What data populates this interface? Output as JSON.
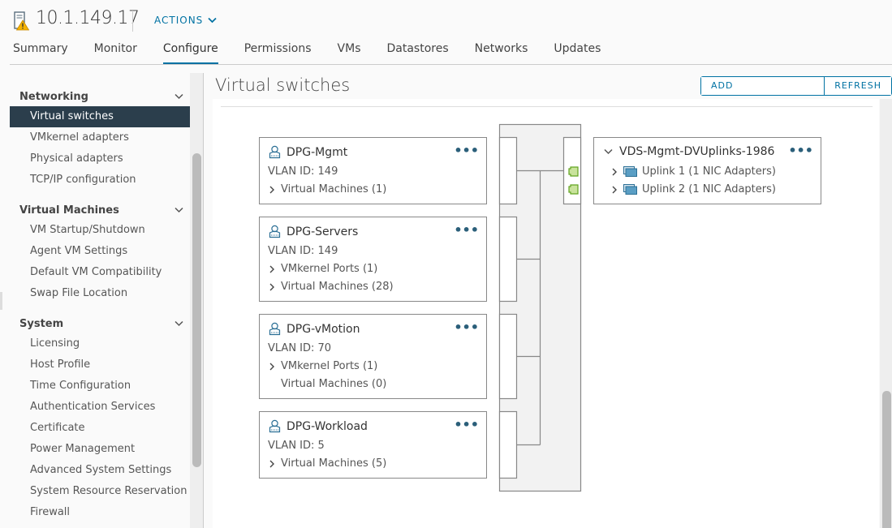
{
  "header": {
    "host_title": "10.1.149.17",
    "host_icon": "host-warning-icon",
    "actions_label": "ACTIONS",
    "tabs": [
      {
        "label": "Summary",
        "active": false
      },
      {
        "label": "Monitor",
        "active": false
      },
      {
        "label": "Configure",
        "active": true
      },
      {
        "label": "Permissions",
        "active": false
      },
      {
        "label": "VMs",
        "active": false
      },
      {
        "label": "Datastores",
        "active": false
      },
      {
        "label": "Networks",
        "active": false
      },
      {
        "label": "Updates",
        "active": false
      }
    ]
  },
  "sidebar": {
    "groups": [
      {
        "label": "Networking",
        "items": [
          "Virtual switches",
          "VMkernel adapters",
          "Physical adapters",
          "TCP/IP configuration"
        ]
      },
      {
        "label": "Virtual Machines",
        "items": [
          "VM Startup/Shutdown",
          "Agent VM Settings",
          "Default VM Compatibility",
          "Swap File Location"
        ]
      },
      {
        "label": "System",
        "items": [
          "Licensing",
          "Host Profile",
          "Time Configuration",
          "Authentication Services",
          "Certificate",
          "Power Management",
          "Advanced System Settings",
          "System Resource Reservation",
          "Firewall"
        ]
      }
    ],
    "selected": "Virtual switches"
  },
  "main": {
    "title": "Virtual switches",
    "add_networking_label": "ADD NETWORKING...",
    "refresh_label": "REFRESH",
    "port_groups": [
      {
        "name": "DPG-Mgmt",
        "vlan": "VLAN ID: 149",
        "rows": [
          {
            "label": "Virtual Machines (1)",
            "expandable": true
          }
        ]
      },
      {
        "name": "DPG-Servers",
        "vlan": "VLAN ID: 149",
        "rows": [
          {
            "label": "VMkernel Ports (1)",
            "expandable": true
          },
          {
            "label": "Virtual Machines (28)",
            "expandable": true
          }
        ]
      },
      {
        "name": "DPG-vMotion",
        "vlan": "VLAN ID: 70",
        "rows": [
          {
            "label": "VMkernel Ports (1)",
            "expandable": true
          },
          {
            "label": "Virtual Machines (0)",
            "expandable": false
          }
        ]
      },
      {
        "name": "DPG-Workload",
        "vlan": "VLAN ID: 5",
        "rows": [
          {
            "label": "Virtual Machines (5)",
            "expandable": true
          }
        ]
      }
    ],
    "uplinks": {
      "name": "VDS-Mgmt-DVUplinks-1986",
      "items": [
        "Uplink 1 (1 NIC Adapters)",
        "Uplink 2 (1 NIC Adapters)"
      ]
    },
    "more_glyph": "•••",
    "colors": {
      "accent": "#0072a3",
      "selected_bg": "#2b3e4c",
      "port_green": "#c9e39c",
      "port_green_border": "#62a420"
    }
  }
}
